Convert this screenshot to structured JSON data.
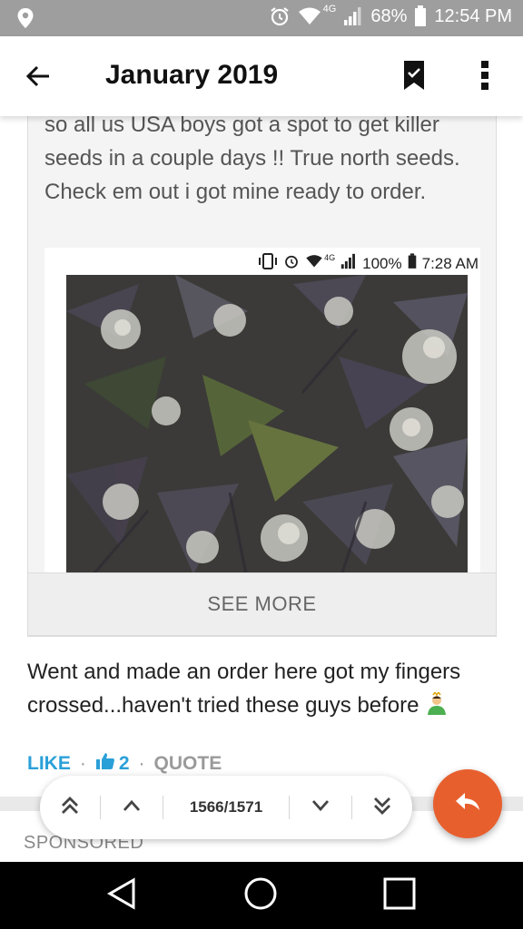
{
  "status_bar": {
    "battery": "68%",
    "time": "12:54 PM",
    "network": "4G"
  },
  "app_bar": {
    "title": "January 2019"
  },
  "quote": {
    "text": "so all us USA boys got a spot to get killer seeds in a couple days !! True north seeds. Check em out i got mine ready to order.",
    "image_status": {
      "network": "4G",
      "battery": "100%",
      "time": "7:28 AM"
    },
    "see_more_label": "SEE MORE"
  },
  "post": {
    "text": "Went and made an order here got my fingers crossed...haven't tried these guys before"
  },
  "actions": {
    "like_label": "LIKE",
    "like_count": "2",
    "quote_label": "QUOTE"
  },
  "sponsored_label": "SPONSORED",
  "pager": {
    "position": "1566/1571"
  },
  "colors": {
    "accent": "#2aa0d8",
    "fab": "#e85f2e",
    "status_bar": "#9e9e9e"
  },
  "icons": [
    "location-icon",
    "alarm-icon",
    "wifi-icon",
    "signal-icon",
    "battery-icon",
    "back-arrow-icon",
    "bookmark-icon",
    "more-vert-icon",
    "thumbs-up-icon",
    "first-page-icon",
    "prev-page-icon",
    "next-page-icon",
    "last-page-icon",
    "reply-icon",
    "nav-back-icon",
    "nav-home-icon",
    "nav-recents-icon"
  ]
}
